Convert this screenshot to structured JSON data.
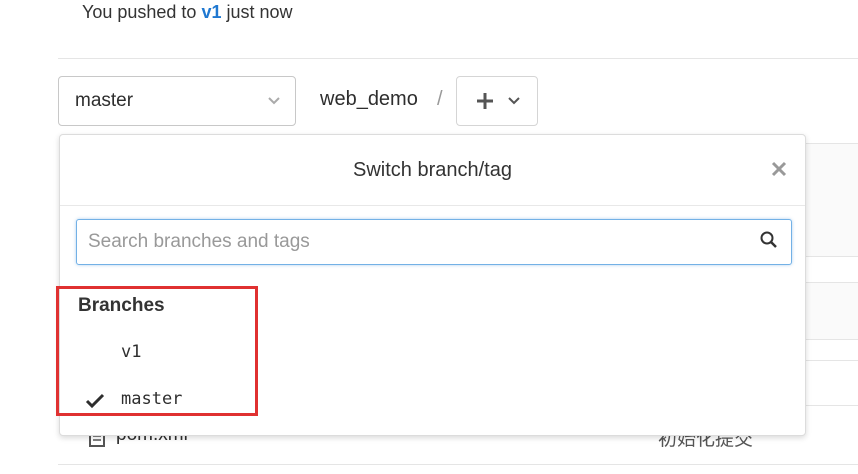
{
  "notice": {
    "prefix": "You pushed to ",
    "branch": "v1",
    "suffix": " just now"
  },
  "branch_selector": {
    "selected": "master"
  },
  "breadcrumb": {
    "repo": "web_demo",
    "separator": "/"
  },
  "add_button": {
    "icon": "plus-icon"
  },
  "dropdown": {
    "title": "Switch branch/tag",
    "search_placeholder": "Search branches and tags",
    "search_value": "",
    "branches_header": "Branches",
    "branches": [
      {
        "name": "v1",
        "selected": false
      },
      {
        "name": "master",
        "selected": true
      }
    ]
  },
  "file_list": {
    "rows": [
      {
        "name": "pom.xml",
        "commit": "初始化提交"
      }
    ]
  },
  "colors": {
    "link": "#1f78d1",
    "highlight": "#e03131",
    "focus": "#73b1e6"
  }
}
